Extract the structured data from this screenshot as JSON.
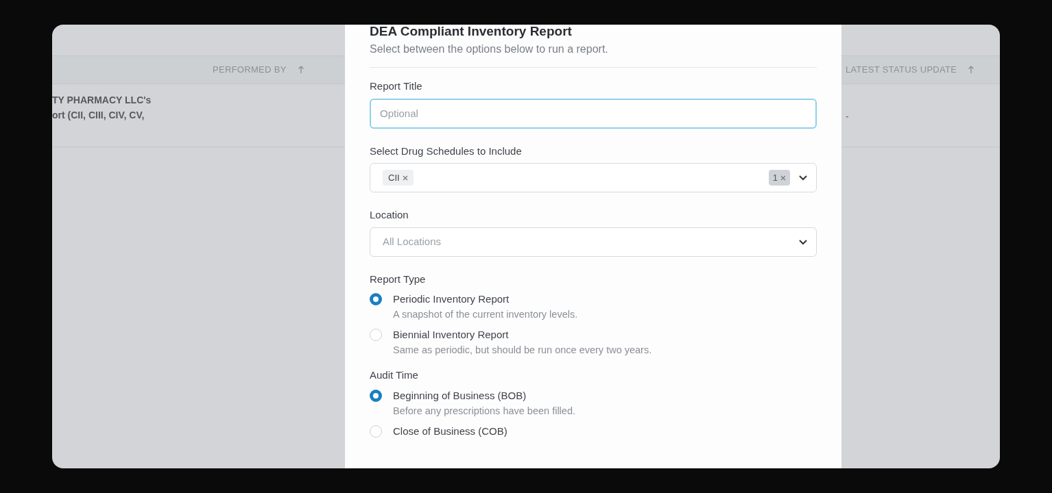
{
  "table": {
    "columns": [
      {
        "label": "PERFORMED BY",
        "sorted_ascending": true
      },
      {
        "label": "LATEST STATUS UPDATE",
        "sorted_ascending": true
      }
    ],
    "rows": [
      {
        "name_lines": [
          "TY PHARMACY LLC's",
          "ort (CII, CIII, CIV, CV,"
        ],
        "latest_status": "-"
      }
    ]
  },
  "modal": {
    "title": "DEA Compliant Inventory Report",
    "subtitle": "Select between the options below to run a report.",
    "report_title": {
      "label": "Report Title",
      "placeholder": "Optional"
    },
    "schedules": {
      "label": "Select Drug Schedules to Include",
      "tags": [
        "CII"
      ],
      "count": "1"
    },
    "location": {
      "label": "Location",
      "placeholder": "All Locations"
    },
    "groups": [
      {
        "label": "Report Type",
        "options": [
          {
            "label": "Periodic Inventory Report",
            "description": "A snapshot of the current inventory levels.",
            "selected": true
          },
          {
            "label": "Biennial Inventory Report",
            "description": "Same as periodic, but should be run once every two years.",
            "selected": false
          }
        ]
      },
      {
        "label": "Audit Time",
        "options": [
          {
            "label": "Beginning of Business (BOB)",
            "description": "Before any prescriptions have been filled.",
            "selected": true
          },
          {
            "label": "Close of Business (COB)",
            "selected": false
          }
        ]
      }
    ]
  }
}
